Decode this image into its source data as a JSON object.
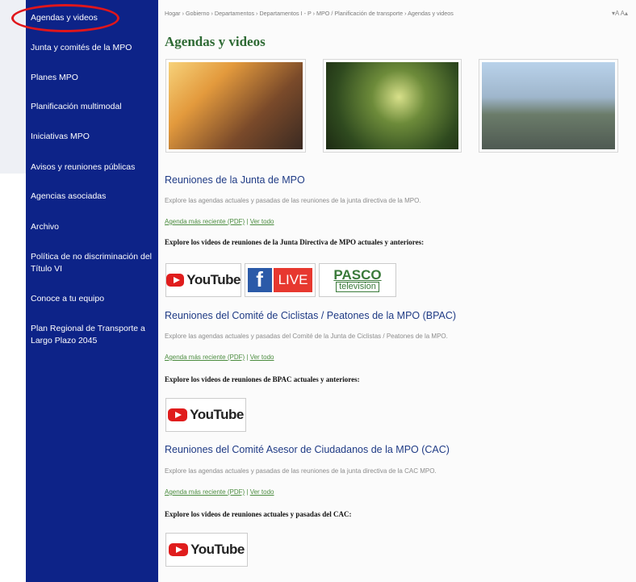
{
  "sidebar": {
    "items": [
      {
        "label": "Agendas y videos"
      },
      {
        "label": "Junta y comités de la MPO"
      },
      {
        "label": "Planes MPO"
      },
      {
        "label": "Planificación multimodal"
      },
      {
        "label": "Iniciativas MPO"
      },
      {
        "label": "Avisos y reuniones públicas"
      },
      {
        "label": "Agencias asociadas"
      },
      {
        "label": "Archivo"
      },
      {
        "label": "Política de no discriminación del Título VI"
      },
      {
        "label": "Conoce a tu equipo"
      },
      {
        "label": "Plan Regional de Transporte a Largo Plazo 2045"
      }
    ]
  },
  "breadcrumb": "Hogar › Gobierno › Departamentos › Departamentos I - P › MPO / Planificación de transporte › Agendas y videos",
  "font_controls": "▾A A▴",
  "page_title": "Agendas y videos",
  "photos": [
    {
      "subject": "cyclist at sunset city street"
    },
    {
      "subject": "bicycle on forest trail"
    },
    {
      "subject": "highway interchange traffic"
    }
  ],
  "sections": [
    {
      "title": "Reuniones de la Junta de MPO",
      "description": "Explore las agendas actuales y pasadas de las reuniones de la junta directiva de la MPO.",
      "link_recent": "Agenda más reciente (PDF)",
      "separator": " | ",
      "link_all": "Ver todo",
      "explore": "Explore los videos de reuniones de la Junta Directiva de MPO actuales y anteriores:"
    },
    {
      "title": "Reuniones del Comité de Ciclistas / Peatones de la MPO (BPAC)",
      "description": "Explore las agendas actuales y pasadas del Comité de la Junta de Ciclistas / Peatones de la MPO.",
      "link_recent": "Agenda más reciente (PDF)",
      "separator": " | ",
      "link_all": "Ver todo",
      "explore": "Explore los videos de reuniones de BPAC actuales y anteriores:"
    },
    {
      "title": "Reuniones del Comité Asesor de Ciudadanos de la MPO (CAC)",
      "description": "Explore las agendas actuales y pasadas de las reuniones de la junta directiva de la CAC MPO.",
      "link_recent": "Agenda más reciente (PDF)",
      "separator": " | ",
      "link_all": "Ver todo",
      "explore": "Explore los videos de reuniones actuales y pasadas del CAC:"
    }
  ],
  "badges": {
    "youtube": "YouTube",
    "facebook_f": "f",
    "live": "LIVE",
    "pasco_top": "PASCO",
    "pasco_bottom": "television"
  },
  "colors": {
    "sidebar_bg": "#0d2388",
    "title_green": "#2e6a34",
    "section_blue": "#1f3b85",
    "link_green": "#4b8c3f",
    "highlight_red": "#e0161b"
  }
}
